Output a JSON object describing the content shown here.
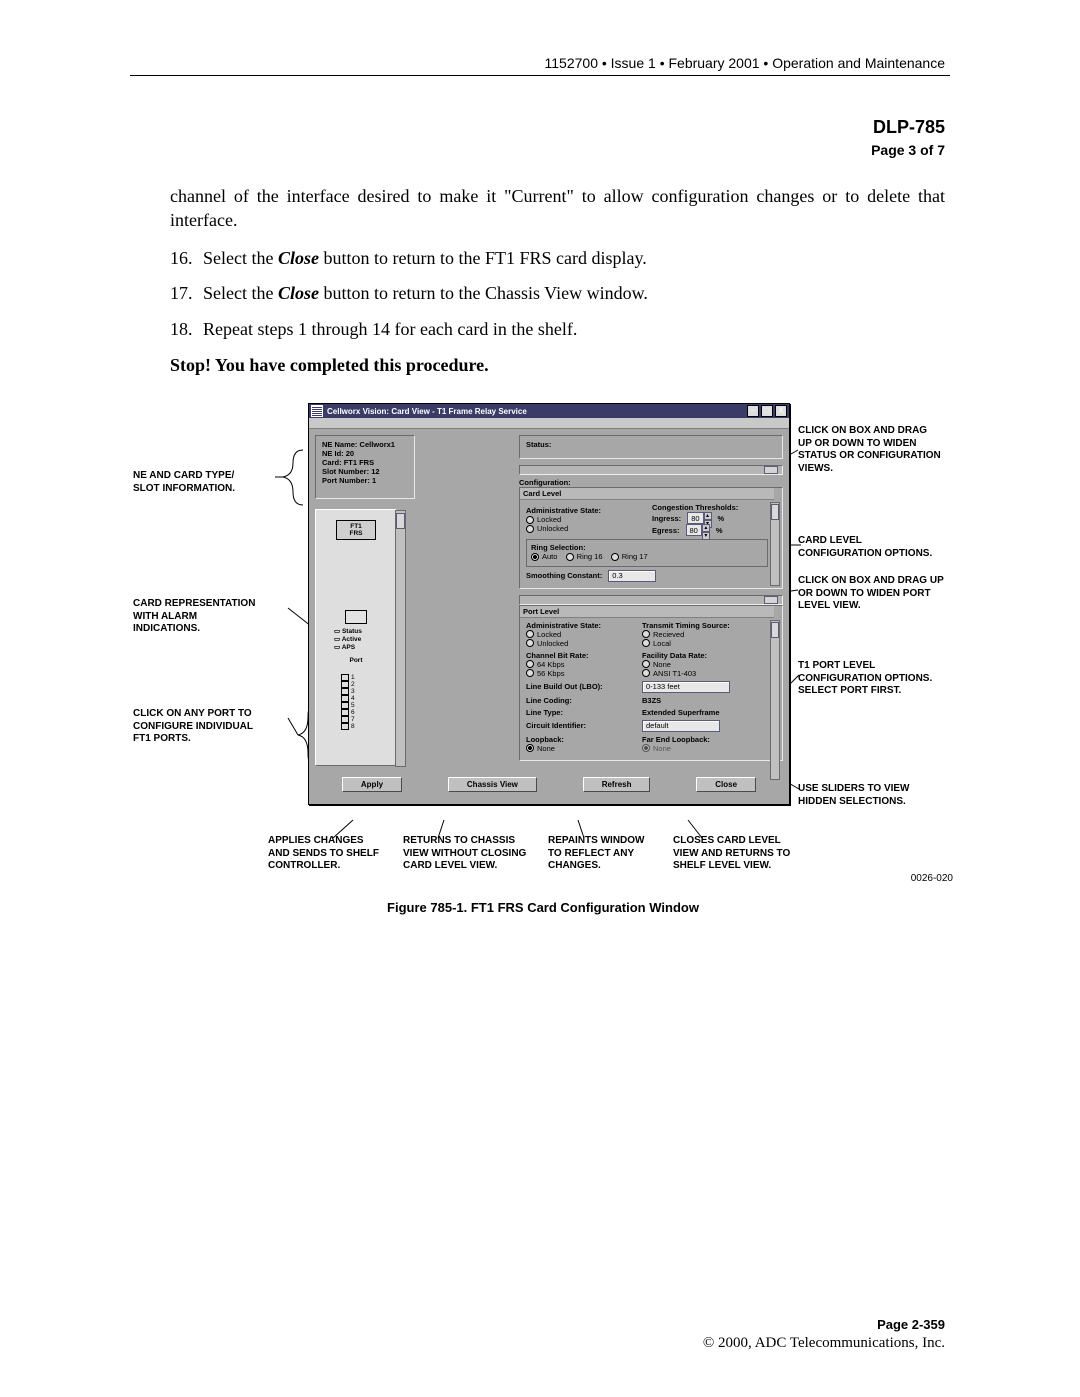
{
  "header": {
    "running": "1152700 • Issue 1 • February 2001 • Operation and Maintenance",
    "dlp": "DLP-785",
    "page_of": "Page 3 of 7"
  },
  "body": {
    "intro": "channel of the interface desired to make it \"Current\" to allow configuration changes or to delete that interface.",
    "steps": [
      {
        "n": "16.",
        "pre": "Select the ",
        "emph": "Close",
        "post": " button to return to the FT1 FRS card display."
      },
      {
        "n": "17.",
        "pre": "Select the ",
        "emph": "Close",
        "post": " button to return to the Chassis View window."
      },
      {
        "n": "18.",
        "pre": "Repeat steps 1 through 14 for each card in the shelf.",
        "emph": "",
        "post": ""
      }
    ],
    "stop": "Stop! You have completed this procedure."
  },
  "figure": {
    "caption": "Figure 785-1. FT1 FRS Card Configuration Window",
    "refno": "0026-020"
  },
  "win": {
    "title": "Cellworx Vision:   Card View - T1 Frame Relay Service",
    "ne": {
      "name_l": "NE Name:",
      "name_v": "Cellworx1",
      "id_l": "NE Id:",
      "id_v": "20",
      "card_l": "Card:",
      "card_v": "FT1 FRS",
      "slot_l": "Slot Number:",
      "slot_v": "12",
      "port_l": "Port Number:",
      "port_v": "1"
    },
    "card_chip": "FT1\nFRS",
    "alarm": {
      "status": "Status",
      "active": "Active",
      "aps": "APS",
      "port": "Port"
    },
    "status_l": "Status:",
    "config_l": "Configuration:",
    "card_level": "Card Level",
    "admin": "Administrative State:",
    "locked": "Locked",
    "unlocked": "Unlocked",
    "cong": "Congestion Thresholds:",
    "ingress_l": "Ingress:",
    "egress_l": "Egress:",
    "pct": "%",
    "val80": "80",
    "ringsel": "Ring Selection:",
    "auto": "Auto",
    "ring16": "Ring 16",
    "ring17": "Ring 17",
    "smooth": "Smoothing Constant:",
    "smooth_v": "0.3",
    "port_level": "Port Level",
    "tts": "Transmit Timing Source:",
    "recv": "Recieved",
    "local": "Local",
    "cbr": "Channel Bit Rate:",
    "k64": "64 Kbps",
    "k56": "56 Kbps",
    "fdr": "Facility Data Rate:",
    "none": "None",
    "ansi": "ANSI T1-403",
    "lbo": "Line Build Out (LBO):",
    "lbo_v": "0-133 feet",
    "lcode": "Line Coding:",
    "lcode_v": "B3ZS",
    "ltype": "Line Type:",
    "ltype_v": "Extended Superframe",
    "circ": "Circuit Identifier:",
    "circ_v": "default",
    "loop": "Loopback:",
    "floop": "Far End Loopback:",
    "nonelbl": "None",
    "btn_apply": "Apply",
    "btn_chassis": "Chassis View",
    "btn_refresh": "Refresh",
    "btn_close": "Close"
  },
  "callouts": {
    "ne": "NE AND CARD TYPE/\nSLOT INFORMATION.",
    "cardrep": "CARD REPRESENTATION\nWITH ALARM\nINDICATIONS.",
    "ports": "CLICK ON ANY PORT TO\nCONFIGURE INDIVIDUAL\nFT1 PORTS.",
    "dragstatus": "CLICK ON BOX AND DRAG\nUP OR DOWN TO WIDEN\nSTATUS OR CONFIGURATION\nVIEWS.",
    "cardlevel": "CARD LEVEL\nCONFIGURATION OPTIONS.",
    "dragport": "CLICK ON BOX AND DRAG UP\nOR DOWN TO WIDEN PORT\nLEVEL VIEW.",
    "t1port": "T1 PORT LEVEL\nCONFIGURATION OPTIONS.\nSELECT PORT FIRST.",
    "sliders": "USE SLIDERS TO VIEW\nHIDDEN SELECTIONS.",
    "apply": "APPLIES CHANGES\nAND SENDS TO SHELF\nCONTROLLER.",
    "chassis": "RETURNS TO CHASSIS\nVIEW WITHOUT CLOSING\nCARD LEVEL VIEW.",
    "refresh": "REPAINTS WINDOW\nTO REFLECT ANY\nCHANGES.",
    "close": "CLOSES CARD LEVEL\nVIEW AND RETURNS TO\nSHELF LEVEL VIEW."
  },
  "footer": {
    "page": "Page 2-359",
    "copyright": "© 2000, ADC Telecommunications, Inc."
  }
}
